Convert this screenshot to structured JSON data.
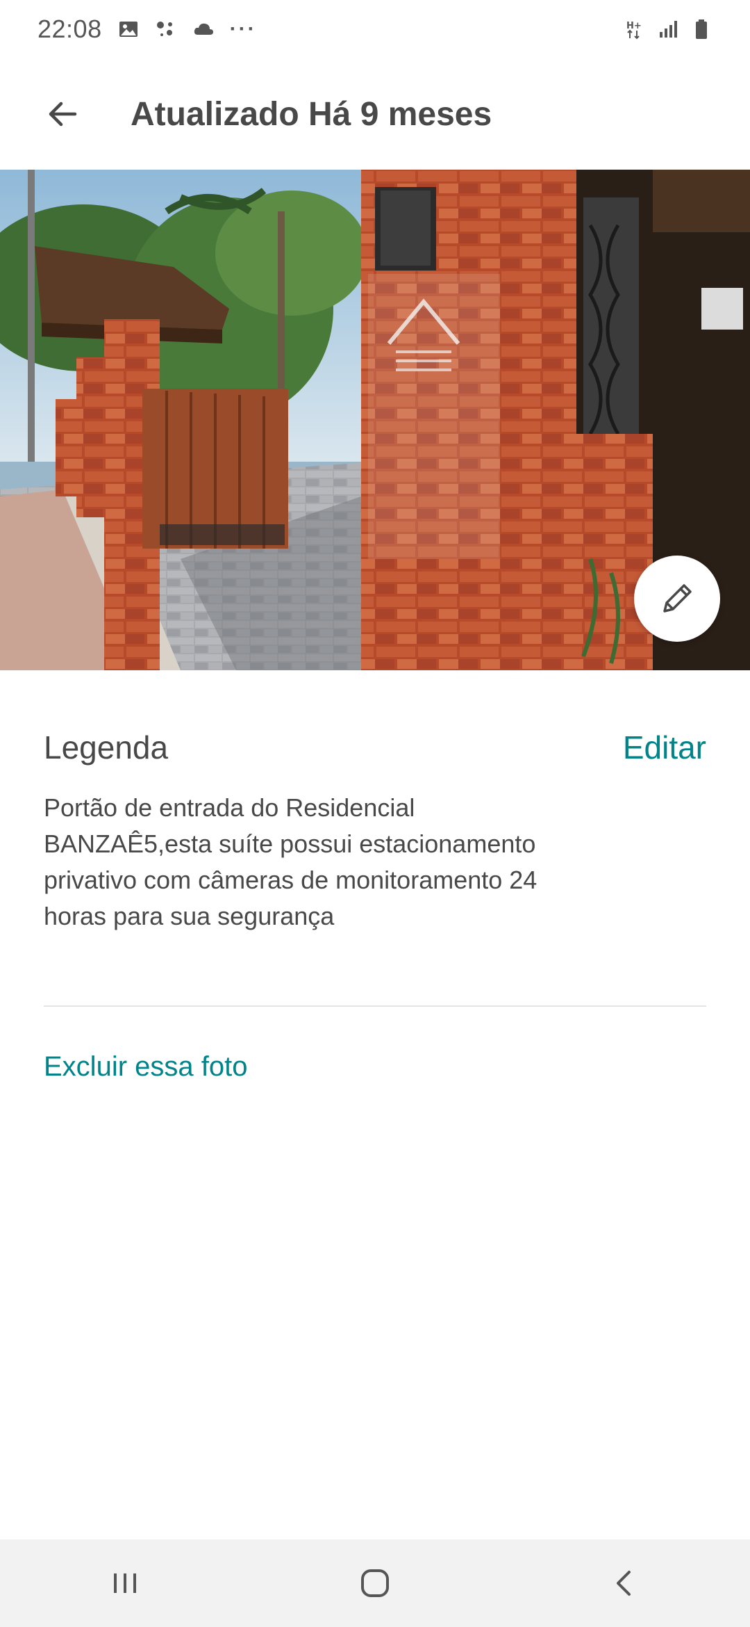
{
  "status_bar": {
    "time": "22:08",
    "icons_left": [
      "image-icon",
      "assistant-dots-icon",
      "cloud-icon",
      "more-dots-icon"
    ],
    "more": "···",
    "icons_right": [
      "data-hplus-icon",
      "signal-icon",
      "battery-icon"
    ]
  },
  "header": {
    "back_icon": "arrow-left-icon",
    "title": "Atualizado Há 9 meses"
  },
  "photo": {
    "edit_icon": "pencil-icon"
  },
  "caption": {
    "label": "Legenda",
    "edit_label": "Editar",
    "text": "Portão de entrada do Residencial BANZAÊ5,esta suíte possui estacionamento privativo com câmeras de monitoramento 24 horas para sua segurança"
  },
  "actions": {
    "delete_label": "Excluir essa foto"
  },
  "nav_bar": {
    "buttons": [
      "recent-apps-icon",
      "home-icon",
      "back-icon"
    ]
  },
  "colors": {
    "accent": "#008489",
    "text": "#484848"
  }
}
